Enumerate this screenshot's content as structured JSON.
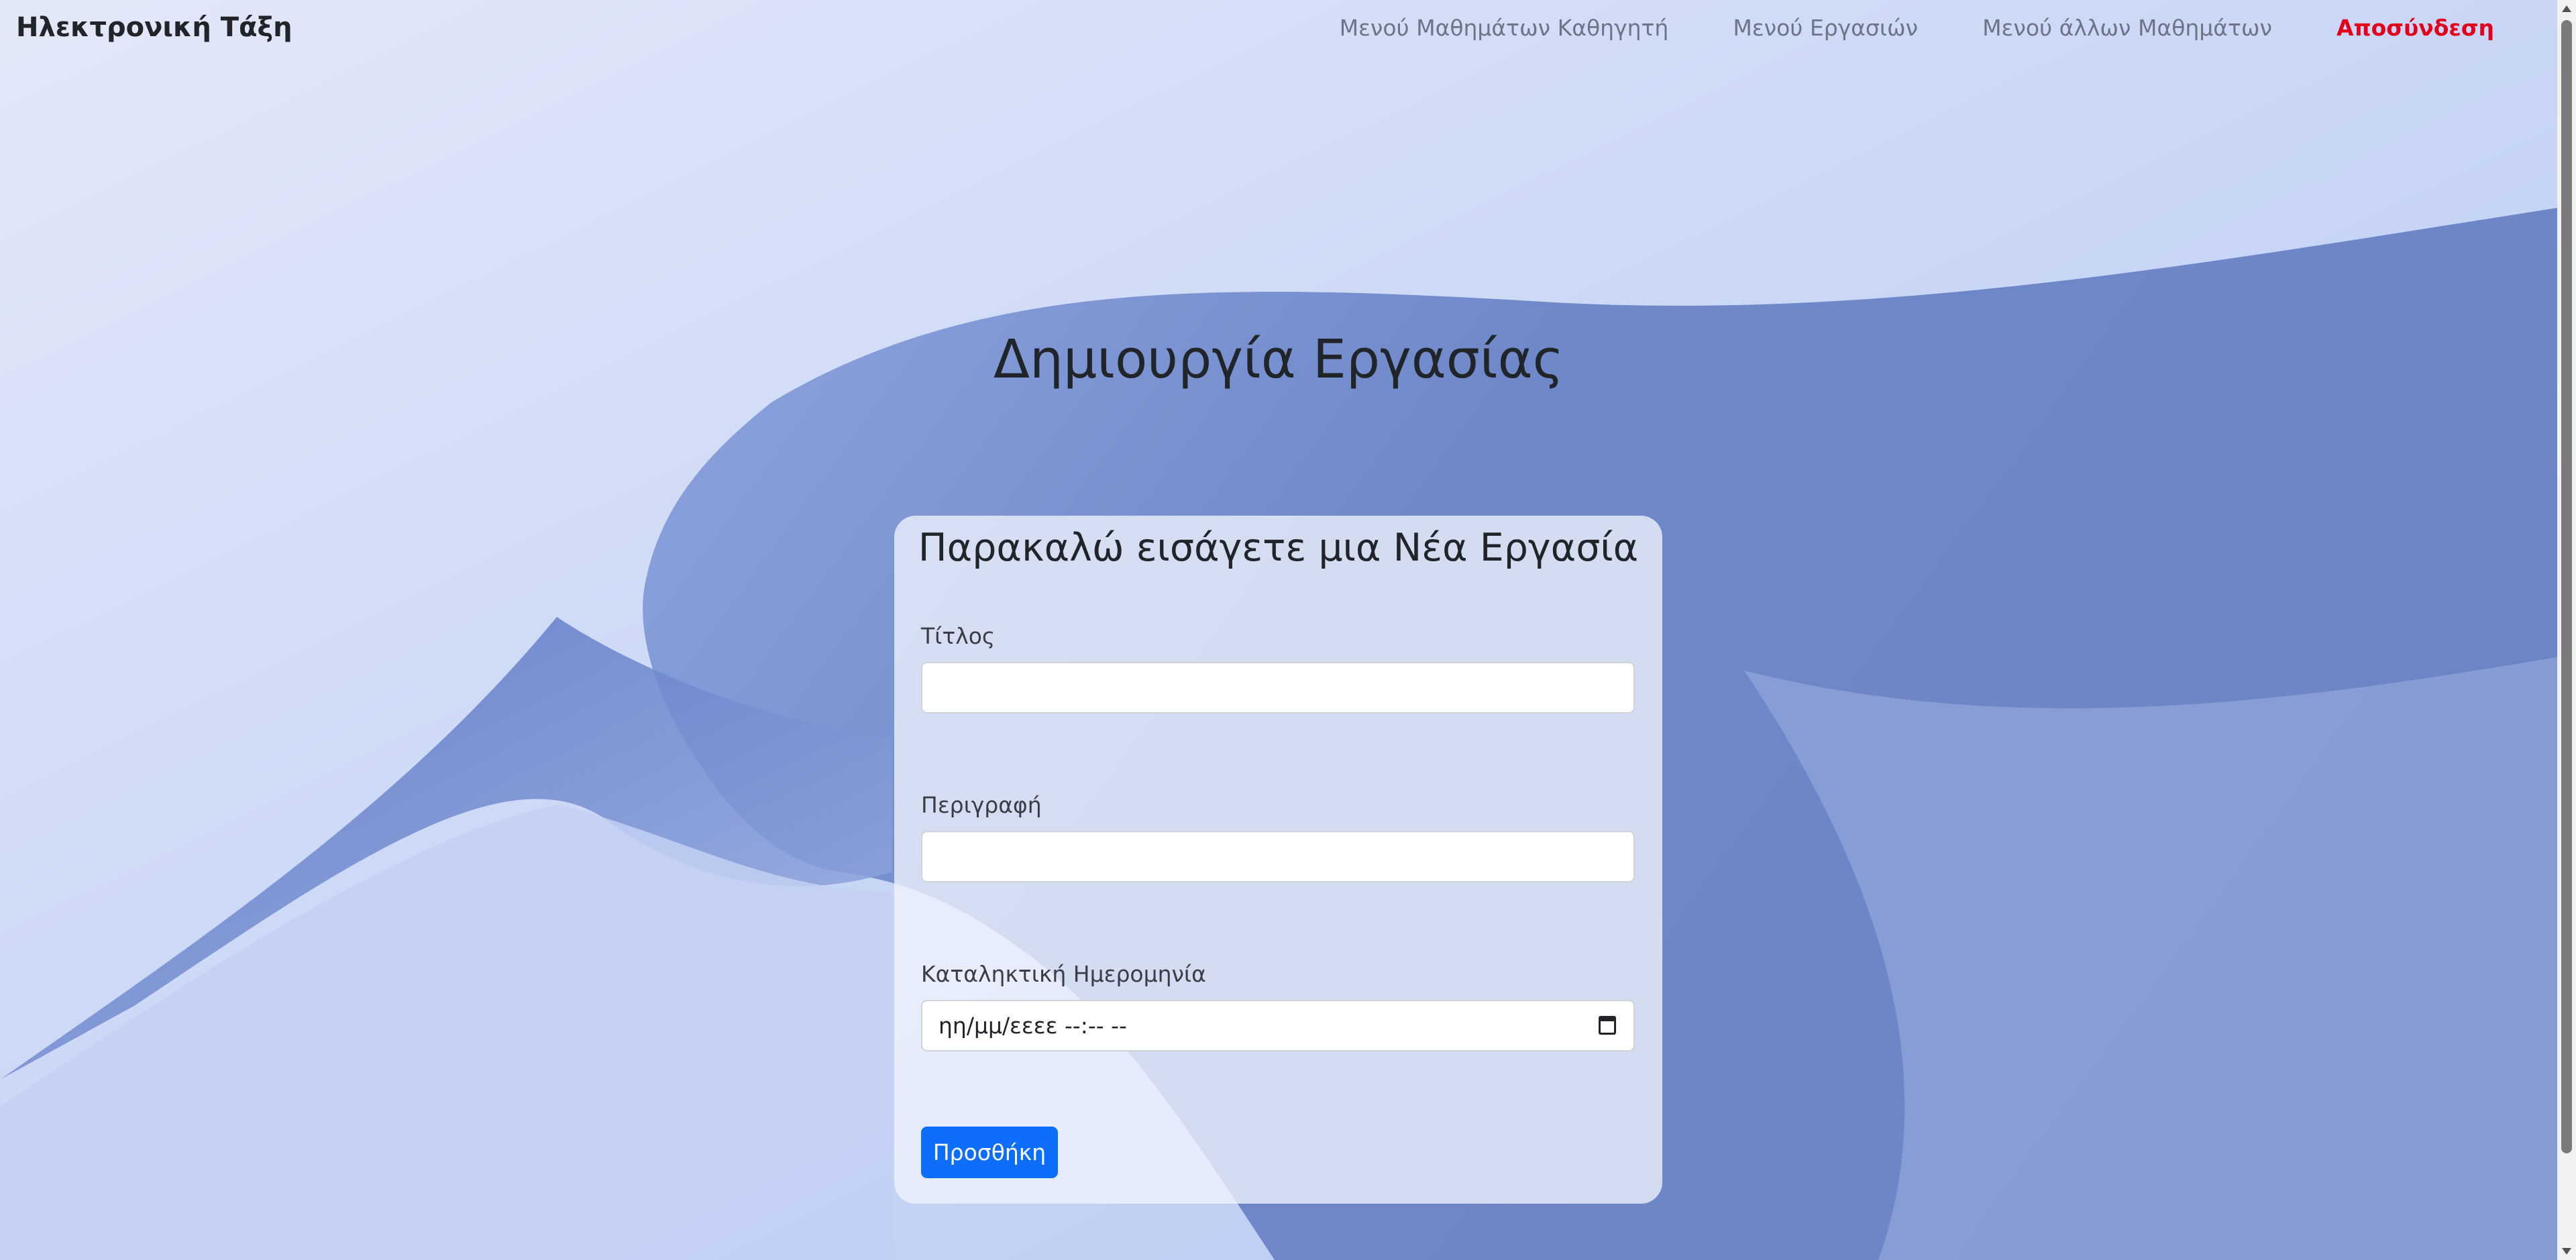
{
  "navbar": {
    "brand": "Ηλεκτρονική Τάξη",
    "links": [
      {
        "label": "Μενού Μαθημάτων Καθηγητή"
      },
      {
        "label": "Μενού Εργασιών"
      },
      {
        "label": "Μενού άλλων Μαθημάτων"
      },
      {
        "label": "Αποσύνδεση"
      }
    ]
  },
  "page": {
    "title": "Δημιουργία Εργασίας"
  },
  "form": {
    "heading": "Παρακαλώ εισάγετε μια Νέα Εργασία",
    "title_label": "Τίτλος",
    "title_value": "",
    "description_label": "Περιγραφή",
    "description_value": "",
    "deadline_label": "Καταληκτική Ημερομηνία",
    "deadline_placeholder": "ηη/μμ/εεεε --:-- --",
    "submit_label": "Προσθήκη"
  },
  "colors": {
    "primary": "#0d6efd",
    "logout": "#e3001b"
  },
  "icons": {
    "calendar": "calendar-icon"
  }
}
